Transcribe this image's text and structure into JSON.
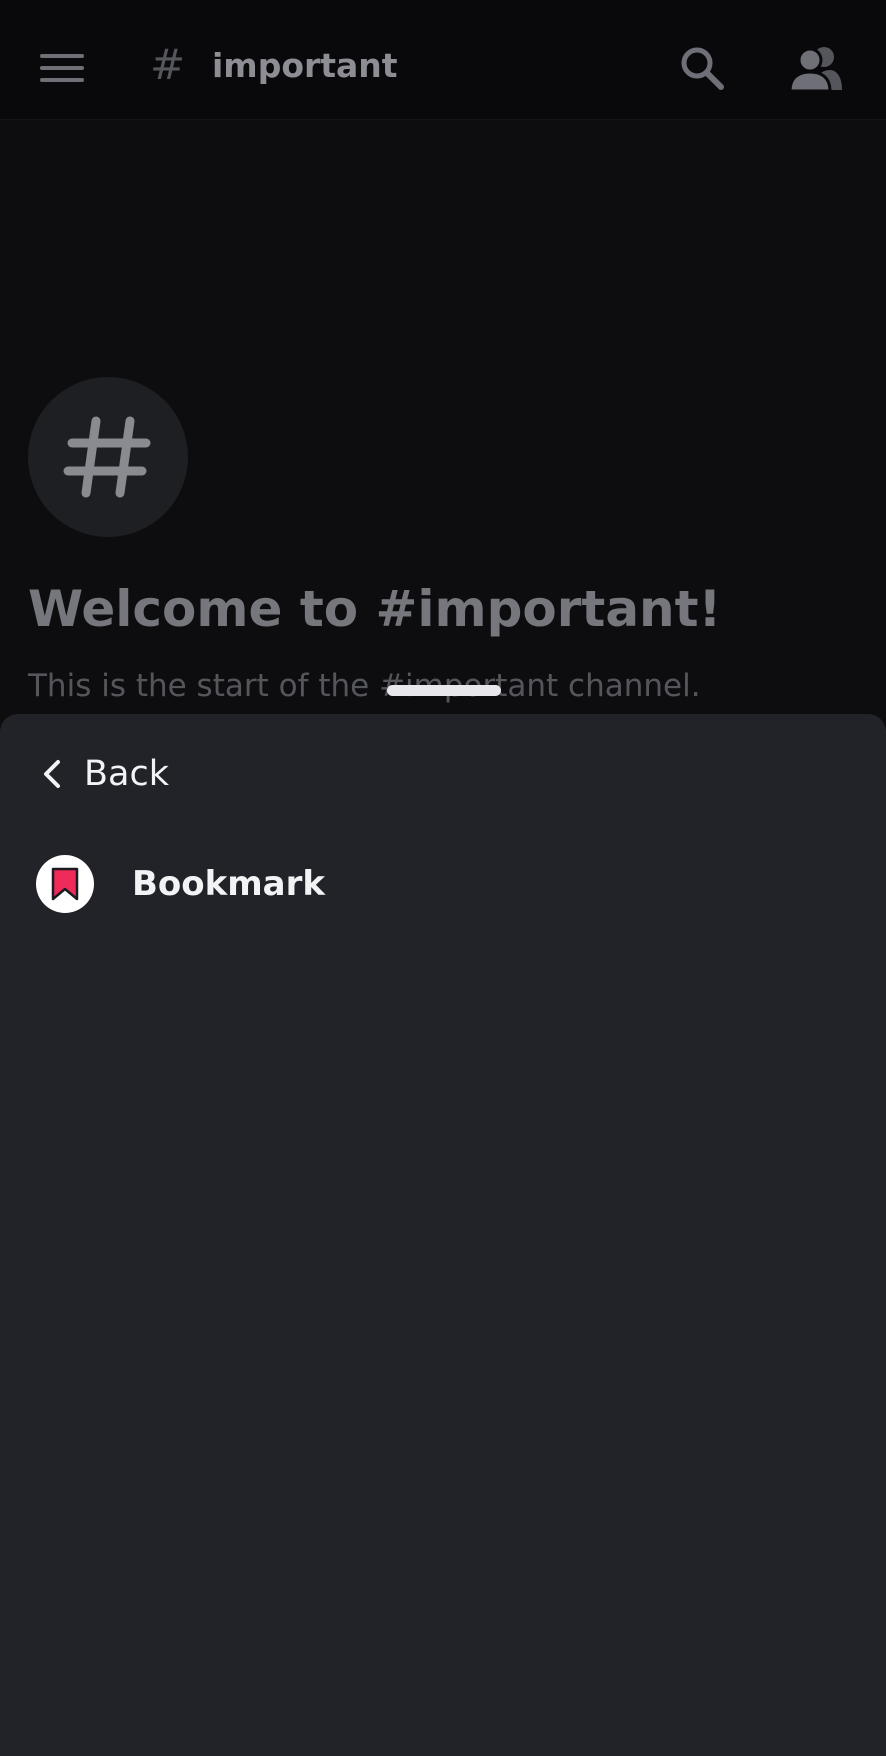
{
  "header": {
    "hash": "#",
    "channel_name": "important"
  },
  "welcome": {
    "avatar_glyph": "#",
    "title": "Welcome to #important!",
    "subtitle": "This is the start of the #important channel."
  },
  "sheet": {
    "back_label": "Back",
    "items": [
      {
        "label": "Bookmark",
        "icon": "bookmark-icon",
        "icon_color": "#ef2b5a"
      }
    ]
  },
  "colors": {
    "background": "#0d0d10",
    "sheet": "#222329",
    "accent": "#ef2b5a"
  }
}
